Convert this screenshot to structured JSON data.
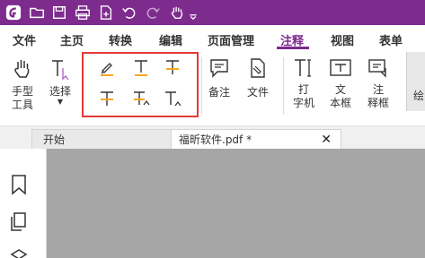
{
  "titlebar": {
    "icons": [
      "app-logo-icon",
      "open-folder-icon",
      "save-icon",
      "print-icon",
      "new-file-icon",
      "undo-icon",
      "redo-icon",
      "hand-tool-icon",
      "customize-arrow-icon"
    ]
  },
  "menu": {
    "tabs": [
      "文件",
      "主页",
      "转换",
      "编辑",
      "页面管理",
      "注释",
      "视图",
      "表单"
    ],
    "active": "注释"
  },
  "ribbon": {
    "hand_tool": {
      "line1": "手型",
      "line2": "工具"
    },
    "select": {
      "label": "选择"
    },
    "annotation_tools": [
      "highlight-icon",
      "underline-text-icon",
      "strikethrough-text-icon",
      "insert-text-icon",
      "replace-text-icon",
      "insert-caret-icon"
    ],
    "note": {
      "label": "备注"
    },
    "file": {
      "label": "文件"
    },
    "typewriter": {
      "line1": "打",
      "line2": "字机"
    },
    "textbox": {
      "line1": "文",
      "line2": "本框"
    },
    "callout": {
      "line1": "注",
      "line2": "释框"
    },
    "draw": {
      "label": "绘"
    },
    "accent_color": "#7e2b8e",
    "highlight_color": "#e53935"
  },
  "tabs": {
    "start": "开始",
    "document": "福昕软件.pdf *"
  }
}
